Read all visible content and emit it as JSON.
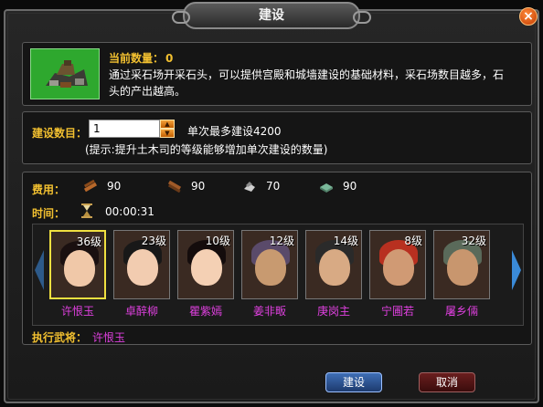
{
  "window": {
    "title": "建设",
    "close_glyph": "×"
  },
  "info": {
    "current_label": "当前数量：",
    "current_value": "0",
    "description": "通过采石场开采石头，可以提供宫殿和城墙建设的基础材料，采石场数目越多，石头的产出越高。",
    "icon": "quarry-building-icon"
  },
  "build": {
    "count_label": "建设数目：",
    "count_value": "1",
    "max_text": "单次最多建设4200",
    "hint": "(提示:提升土木司的等级能够增加单次建设的数量)"
  },
  "cost": {
    "label": "费用：",
    "resources": [
      {
        "icon": "wood-icon",
        "value": "90"
      },
      {
        "icon": "lumber-icon",
        "value": "90"
      },
      {
        "icon": "iron-icon",
        "value": "70"
      },
      {
        "icon": "stone-icon",
        "value": "90"
      }
    ]
  },
  "time": {
    "label": "时间：",
    "icon": "hourglass-icon",
    "value": "00:00:31"
  },
  "generals": [
    {
      "name": "许恨玉",
      "level": "36级",
      "selected": true
    },
    {
      "name": "卓醉柳",
      "level": "23级",
      "selected": false
    },
    {
      "name": "瞿紫嫣",
      "level": "10级",
      "selected": false
    },
    {
      "name": "姜非畈",
      "level": "12级",
      "selected": false
    },
    {
      "name": "庚岗主",
      "level": "14级",
      "selected": false
    },
    {
      "name": "宁圃若",
      "level": "8级",
      "selected": false
    },
    {
      "name": "屠乡倆",
      "level": "32级",
      "selected": false
    }
  ],
  "executor": {
    "label": "执行武将：",
    "value": "许恨玉"
  },
  "buttons": {
    "build": "建设",
    "cancel": "取消"
  },
  "colors": {
    "accent_gold": "#f2c030",
    "general_name": "#e040e0",
    "icon_bg": "#2ea82e"
  }
}
